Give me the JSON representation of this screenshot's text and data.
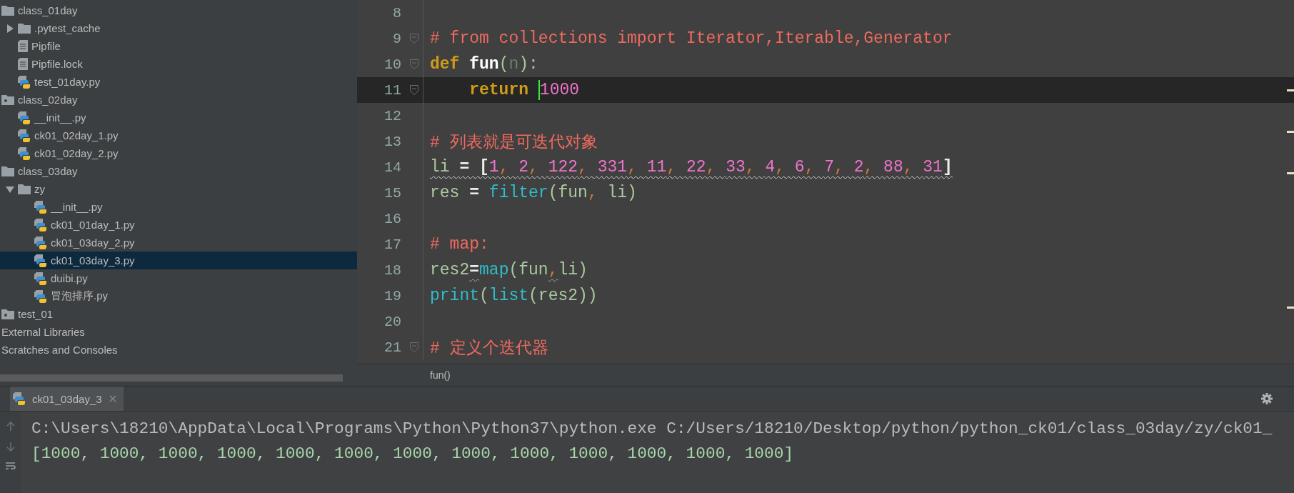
{
  "project_tree": {
    "items": [
      {
        "label": "class_01day",
        "kind": "folder",
        "selected": false,
        "children": [
          {
            "label": ".pytest_cache",
            "kind": "folder",
            "selected": false,
            "expanded": false
          },
          {
            "label": "Pipfile",
            "kind": "text-file",
            "selected": false
          },
          {
            "label": "Pipfile.lock",
            "kind": "text-file",
            "selected": false
          },
          {
            "label": "test_01day.py",
            "kind": "python-file",
            "selected": false
          }
        ]
      },
      {
        "label": "class_02day",
        "kind": "module-folder",
        "selected": false,
        "children": [
          {
            "label": "__init__.py",
            "kind": "python-file",
            "selected": false
          },
          {
            "label": "ck01_02day_1.py",
            "kind": "python-file",
            "selected": false
          },
          {
            "label": "ck01_02day_2.py",
            "kind": "python-file",
            "selected": false
          }
        ]
      },
      {
        "label": "class_03day",
        "kind": "folder",
        "selected": false,
        "children": [
          {
            "label": "zy",
            "kind": "folder",
            "selected": false,
            "expanded": true,
            "children": [
              {
                "label": "__init__.py",
                "kind": "python-file",
                "selected": false
              },
              {
                "label": "ck01_01day_1.py",
                "kind": "python-file",
                "selected": false
              },
              {
                "label": "ck01_03day_2.py",
                "kind": "python-file",
                "selected": false
              },
              {
                "label": "ck01_03day_3.py",
                "kind": "python-file",
                "selected": true
              },
              {
                "label": "duibi.py",
                "kind": "python-file",
                "selected": false
              },
              {
                "label": "冒泡排序.py",
                "kind": "python-file",
                "selected": false
              }
            ]
          }
        ]
      },
      {
        "label": "test_01",
        "kind": "module-folder",
        "selected": false
      },
      {
        "label": "External Libraries",
        "kind": "plain",
        "selected": false
      },
      {
        "label": "Scratches and Consoles",
        "kind": "plain",
        "selected": false
      }
    ]
  },
  "editor": {
    "lines": [
      {
        "number": "8",
        "current": false,
        "fold": false
      },
      {
        "number": "9",
        "current": false,
        "fold": true,
        "tokens": [
          {
            "kind": "comment",
            "text": "# from collections import Iterator,Iterable,Generator"
          }
        ]
      },
      {
        "number": "10",
        "current": false,
        "fold": true,
        "tokens": [
          {
            "kind": "keyword",
            "text": "def "
          },
          {
            "kind": "function",
            "text": "fun"
          },
          {
            "kind": "ident",
            "text": "("
          },
          {
            "kind": "param",
            "text": "n"
          },
          {
            "kind": "ident",
            "text": "):"
          }
        ]
      },
      {
        "number": "11",
        "current": true,
        "fold": true,
        "indented": true,
        "tokens": [
          {
            "kind": "keyword",
            "text": "return "
          },
          {
            "kind": "caret"
          },
          {
            "kind": "number",
            "text": "1000"
          }
        ]
      },
      {
        "number": "12",
        "current": false,
        "fold": false
      },
      {
        "number": "13",
        "current": false,
        "fold": false,
        "tokens": [
          {
            "kind": "comment",
            "text": "# 列表就是可迭代对象"
          }
        ]
      },
      {
        "number": "14",
        "current": false,
        "fold": false,
        "warning": true,
        "tokens": [
          {
            "kind": "ident",
            "text": "li "
          },
          {
            "kind": "operator",
            "text": "= ["
          },
          {
            "kind": "number",
            "text": "1"
          },
          {
            "kind": "comma",
            "text": ", "
          },
          {
            "kind": "number",
            "text": "2"
          },
          {
            "kind": "comma",
            "text": ", "
          },
          {
            "kind": "number",
            "text": "122"
          },
          {
            "kind": "comma",
            "text": ", "
          },
          {
            "kind": "number",
            "text": "331"
          },
          {
            "kind": "comma",
            "text": ", "
          },
          {
            "kind": "number",
            "text": "11"
          },
          {
            "kind": "comma",
            "text": ", "
          },
          {
            "kind": "number",
            "text": "22"
          },
          {
            "kind": "comma",
            "text": ", "
          },
          {
            "kind": "number",
            "text": "33"
          },
          {
            "kind": "comma",
            "text": ", "
          },
          {
            "kind": "number",
            "text": "4"
          },
          {
            "kind": "comma",
            "text": ", "
          },
          {
            "kind": "number",
            "text": "6"
          },
          {
            "kind": "comma",
            "text": ", "
          },
          {
            "kind": "number",
            "text": "7"
          },
          {
            "kind": "comma",
            "text": ", "
          },
          {
            "kind": "number",
            "text": "2"
          },
          {
            "kind": "comma",
            "text": ", "
          },
          {
            "kind": "number",
            "text": "88"
          },
          {
            "kind": "comma",
            "text": ", "
          },
          {
            "kind": "number",
            "text": "31"
          },
          {
            "kind": "operator",
            "text": "]"
          }
        ]
      },
      {
        "number": "15",
        "current": false,
        "fold": false,
        "tokens": [
          {
            "kind": "ident",
            "text": "res "
          },
          {
            "kind": "operator",
            "text": "= "
          },
          {
            "kind": "builtin",
            "text": "filter"
          },
          {
            "kind": "ident",
            "text": "(fun"
          },
          {
            "kind": "comma",
            "text": ", "
          },
          {
            "kind": "ident",
            "text": "li)"
          }
        ]
      },
      {
        "number": "16",
        "current": false,
        "fold": false
      },
      {
        "number": "17",
        "current": false,
        "fold": false,
        "tokens": [
          {
            "kind": "comment",
            "text": "# map:"
          }
        ]
      },
      {
        "number": "18",
        "current": false,
        "fold": false,
        "tokens": [
          {
            "kind": "ident",
            "text": "res2"
          },
          {
            "kind": "operator",
            "text": "=",
            "warning": true
          },
          {
            "kind": "builtin",
            "text": "map"
          },
          {
            "kind": "ident",
            "text": "(fun"
          },
          {
            "kind": "comma",
            "text": ",",
            "warning": true
          },
          {
            "kind": "ident",
            "text": "li)"
          }
        ]
      },
      {
        "number": "19",
        "current": false,
        "fold": false,
        "tokens": [
          {
            "kind": "builtin",
            "text": "print"
          },
          {
            "kind": "ident",
            "text": "("
          },
          {
            "kind": "builtin",
            "text": "list"
          },
          {
            "kind": "ident",
            "text": "(res2))"
          }
        ]
      },
      {
        "number": "20",
        "current": false,
        "fold": false
      },
      {
        "number": "21",
        "current": false,
        "fold": true,
        "tokens": [
          {
            "kind": "comment",
            "text": "# 定义个迭代器"
          }
        ]
      }
    ],
    "breadcrumb": "fun()"
  },
  "run_panel": {
    "tabs": [
      {
        "label": "ck01_03day_3",
        "selected": true
      }
    ],
    "output": [
      "C:\\Users\\18210\\AppData\\Local\\Programs\\Python\\Python37\\python.exe C:/Users/18210/Desktop/python/python_ck01/class_03day/zy/ck01_",
      "[1000, 1000, 1000, 1000, 1000, 1000, 1000, 1000, 1000, 1000, 1000, 1000, 1000]"
    ]
  }
}
